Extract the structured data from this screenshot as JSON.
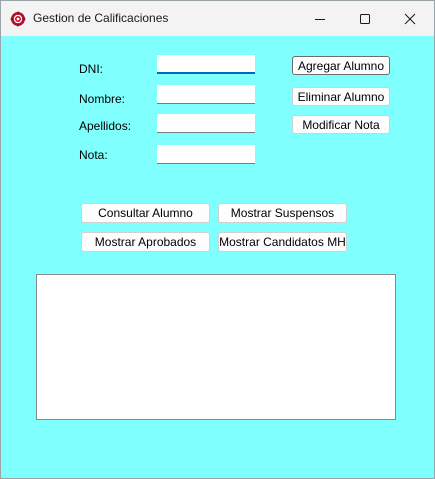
{
  "window": {
    "title": "Gestion de Calificaciones",
    "background_color": "#80ffff"
  },
  "title_controls": {
    "minimize_icon": "minimize-icon",
    "maximize_icon": "maximize-icon",
    "close_icon": "close-icon"
  },
  "form": {
    "dni_label": "DNI:",
    "nombre_label": "Nombre:",
    "apellidos_label": "Apellidos:",
    "nota_label": "Nota:",
    "dni_value": "",
    "nombre_value": "",
    "apellidos_value": "",
    "nota_value": ""
  },
  "buttons": {
    "agregar": "Agregar Alumno",
    "eliminar": "Eliminar Alumno",
    "modificar": "Modificar Nota",
    "consultar": "Consultar Alumno",
    "suspensos": "Mostrar Suspensos",
    "aprobados": "Mostrar Aprobados",
    "candidatos": "Mostrar Candidatos MH"
  },
  "output": {
    "text": ""
  }
}
